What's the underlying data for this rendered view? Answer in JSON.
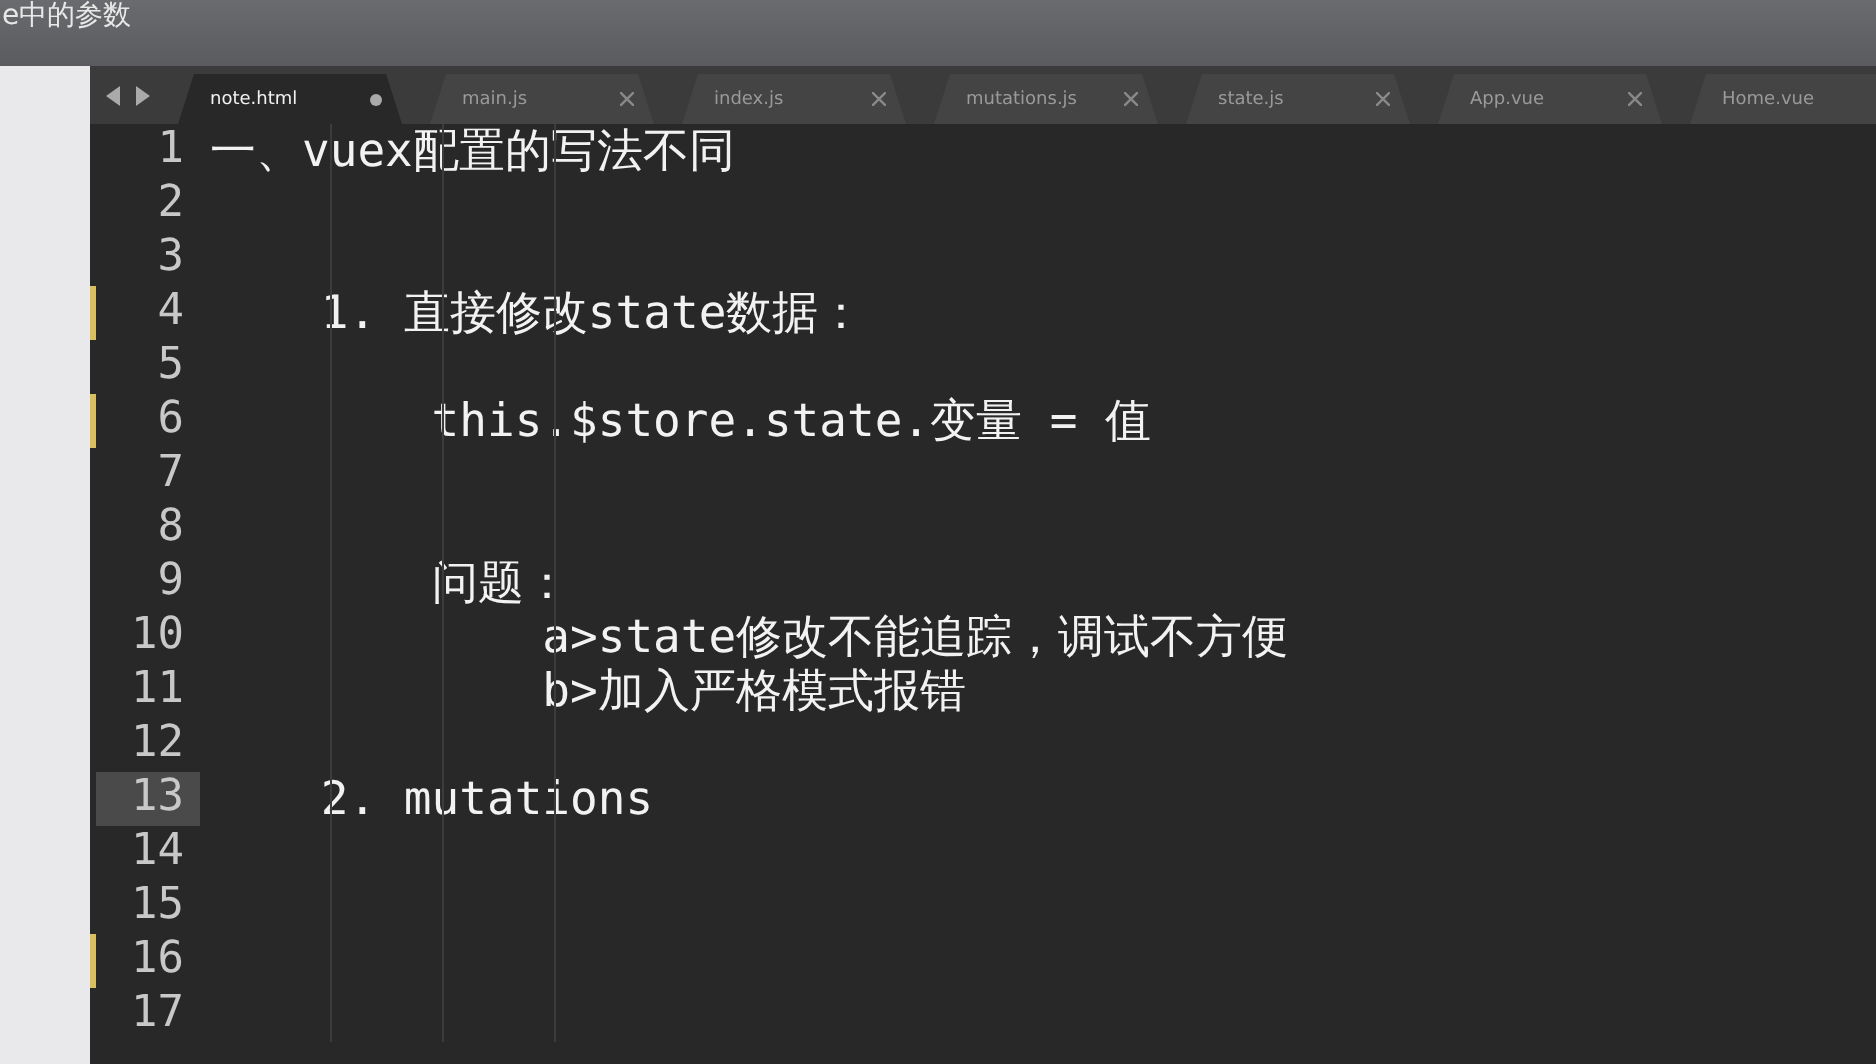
{
  "video_title": "e中的参数",
  "tabs": [
    {
      "label": "note.html",
      "selected": true,
      "dirty": true
    },
    {
      "label": "main.js",
      "selected": false,
      "dirty": false
    },
    {
      "label": "index.js",
      "selected": false,
      "dirty": false
    },
    {
      "label": "mutations.js",
      "selected": false,
      "dirty": false
    },
    {
      "label": "state.js",
      "selected": false,
      "dirty": false
    },
    {
      "label": "App.vue",
      "selected": false,
      "dirty": false
    },
    {
      "label": "Home.vue",
      "selected": false
    }
  ],
  "lines": [
    {
      "number": "1",
      "text": "一、vuex配置的写法不同",
      "modified": false,
      "current": false
    },
    {
      "number": "2",
      "modified": false,
      "current": false
    },
    {
      "number": "3",
      "modified": false,
      "current": false
    },
    {
      "number": "4",
      "text": "    1. 直接修改state数据：",
      "modified": true,
      "current": false
    },
    {
      "number": "5",
      "modified": false,
      "current": false
    },
    {
      "number": "6",
      "text": "        this.$store.state.变量 = 值",
      "modified": true,
      "current": false
    },
    {
      "number": "7",
      "modified": false,
      "current": false
    },
    {
      "number": "8",
      "modified": false,
      "current": false
    },
    {
      "number": "9",
      "text": "        问题：",
      "modified": false,
      "current": false
    },
    {
      "number": "10",
      "text": "            a>state修改不能追踪，调试不方便",
      "modified": false,
      "current": false
    },
    {
      "number": "11",
      "text": "            b>加入严格模式报错",
      "modified": false,
      "current": false
    },
    {
      "number": "12",
      "modified": false,
      "current": false
    },
    {
      "number": "13",
      "text": "    2. mutations",
      "modified": false,
      "current": true
    },
    {
      "number": "14",
      "modified": false,
      "current": false
    },
    {
      "number": "15",
      "modified": false,
      "current": false
    },
    {
      "number": "16",
      "modified": true,
      "current": false
    },
    {
      "number": "17",
      "modified": false,
      "current": false
    }
  ]
}
